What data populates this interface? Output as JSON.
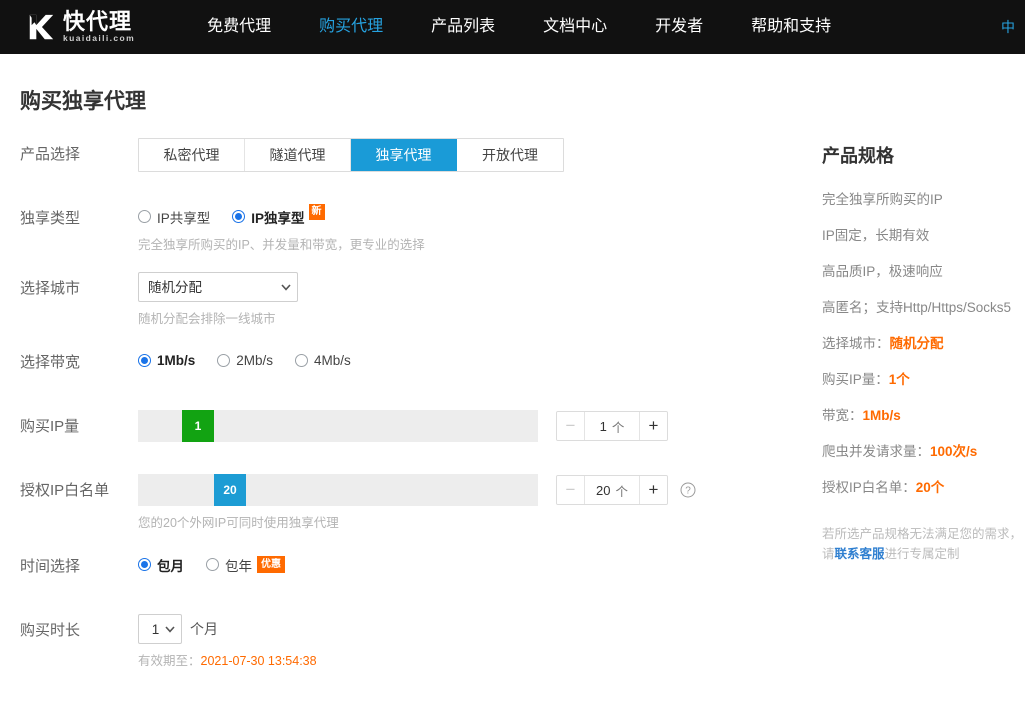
{
  "header": {
    "brand": {
      "name": "快代理",
      "domain": "kuaidaili.com",
      "logo_icon": "k-logo-icon"
    },
    "nav": [
      {
        "label": "免费代理",
        "active": false
      },
      {
        "label": "购买代理",
        "active": true
      },
      {
        "label": "产品列表",
        "active": false
      },
      {
        "label": "文档中心",
        "active": false
      },
      {
        "label": "开发者",
        "active": false
      },
      {
        "label": "帮助和支持",
        "active": false
      }
    ],
    "right_clipped_label": "中"
  },
  "page": {
    "title": "购买独享代理"
  },
  "form": {
    "product_select": {
      "label": "产品选择",
      "tabs": [
        {
          "label": "私密代理",
          "active": false
        },
        {
          "label": "隧道代理",
          "active": false
        },
        {
          "label": "独享代理",
          "active": true
        },
        {
          "label": "开放代理",
          "active": false
        }
      ]
    },
    "exclusive_type": {
      "label": "独享类型",
      "options": [
        {
          "label": "IP共享型",
          "checked": false,
          "badge": ""
        },
        {
          "label": "IP独享型",
          "checked": true,
          "badge": "新"
        }
      ],
      "hint": "完全独享所购买的IP、并发量和带宽，更专业的选择"
    },
    "city": {
      "label": "选择城市",
      "value": "随机分配",
      "options": [
        "随机分配"
      ],
      "hint": "随机分配会排除一线城市"
    },
    "bandwidth": {
      "label": "选择带宽",
      "options": [
        {
          "label": "1Mb/s",
          "checked": true
        },
        {
          "label": "2Mb/s",
          "checked": false
        },
        {
          "label": "4Mb/s",
          "checked": false
        }
      ]
    },
    "ip_quantity": {
      "label": "购买IP量",
      "handle_value": "1",
      "stepper_value": "1",
      "stepper_unit": "个",
      "minus_label": "−",
      "plus_label": "+",
      "handle_percent": 11
    },
    "ip_whitelist": {
      "label": "授权IP白名单",
      "handle_value": "20",
      "stepper_value": "20",
      "stepper_unit": "个",
      "minus_label": "−",
      "plus_label": "+",
      "handle_percent": 19,
      "help_icon": "question-mark-icon",
      "hint": "您的20个外网IP可同时使用独享代理"
    },
    "time_select": {
      "label": "时间选择",
      "options": [
        {
          "label": "包月",
          "checked": true,
          "badge": ""
        },
        {
          "label": "包年",
          "checked": false,
          "badge": "优惠"
        }
      ]
    },
    "duration": {
      "label": "购买时长",
      "value": "1",
      "options": [
        "1"
      ],
      "unit": "个月",
      "expiry_prefix": "有效期至：",
      "expiry_value": "2021-07-30 13:54:38"
    }
  },
  "spec_panel": {
    "title": "产品规格",
    "features": [
      "完全独享所购买的IP",
      "IP固定，长期有效",
      "高品质IP，极速响应",
      "高匿名；支持Http/Https/Socks5"
    ],
    "items": [
      {
        "key": "选择城市：",
        "value": "随机分配"
      },
      {
        "key": "购买IP量：",
        "value": "1个"
      },
      {
        "key": "带宽：",
        "value": "1Mb/s"
      },
      {
        "key": "爬虫并发请求量：",
        "value": "100次/s"
      },
      {
        "key": "授权IP白名单：",
        "value": "20个"
      }
    ],
    "note_line1": "若所选产品规格无法满足您的需求，",
    "note_prefix": "请",
    "note_link": "联系客服",
    "note_suffix": "进行专属定制"
  },
  "colors": {
    "brand_blue": "#1a9bd7",
    "accent_orange": "#ff6a00",
    "radio_blue": "#1a73e8",
    "slider_green": "#12a312",
    "slider_blue": "#1d9cd4",
    "header_bg": "#111111"
  }
}
